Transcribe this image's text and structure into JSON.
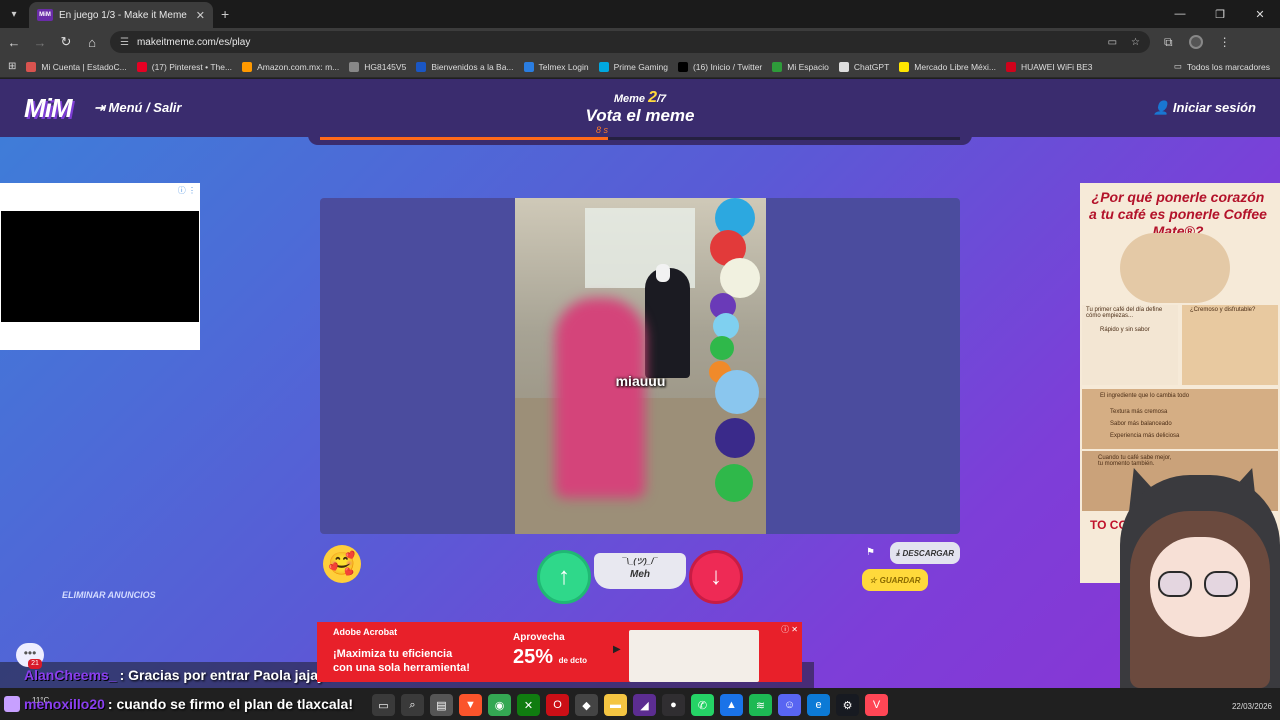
{
  "browser": {
    "tab_title": "En juego 1/3 - Make it Meme",
    "tab_favicon": "MiM",
    "url": "makeitmeme.com/es/play",
    "bookmarks": [
      {
        "label": "Mi Cuenta | EstadoC...",
        "color": "#d9534f"
      },
      {
        "label": "(17) Pinterest • The...",
        "color": "#e60023"
      },
      {
        "label": "Amazon.com.mx: m...",
        "color": "#ff9900"
      },
      {
        "label": "HG8145V5",
        "color": "#888888"
      },
      {
        "label": "Bienvenidos a la Ba...",
        "color": "#1a56c4"
      },
      {
        "label": "Telmex Login",
        "color": "#2a7de1"
      },
      {
        "label": "Prime Gaming",
        "color": "#00a8e1"
      },
      {
        "label": "(16) Inicio / Twitter",
        "color": "#000000"
      },
      {
        "label": "Mi Espacio",
        "color": "#2e9b3a"
      },
      {
        "label": "ChatGPT",
        "color": "#dddddd"
      },
      {
        "label": "Mercado Libre Méxi...",
        "color": "#ffe600"
      },
      {
        "label": "HUAWEI WiFi BE3",
        "color": "#d0021b"
      }
    ],
    "all_bookmarks": "Todos los marcadores"
  },
  "game": {
    "logo": "MiM",
    "menu_label": "Menú / Salir",
    "login_label": "Iniciar sesión",
    "round_prefix": "Meme",
    "round_current": "2",
    "round_total": "/7",
    "vote_title": "Vota el meme",
    "timer": "8 s",
    "timer_progress": 0.45,
    "meme_caption": "miauuu",
    "meh_face": "¯\\_(ツ)_/¯",
    "meh_label": "Meh",
    "download_label": "DESCARGAR",
    "save_label": "GUARDAR",
    "remove_ads": "ELIMINAR ANUNCIOS"
  },
  "ads": {
    "right_headline": "¿Por qué ponerle corazón a tu café es ponerle Coffee Mate®?",
    "right_texts": [
      "Tu primer café del día define cómo empiezas...",
      "Rápido y sin sabor",
      "¿Cremoso y disfrutable?",
      "El ingrediente que lo cambia todo",
      "Textura más cremosa",
      "Sabor más balanceado",
      "Experiencia más deliciosa",
      "Cuando tu café sabe mejor, tu momento también."
    ],
    "right_promo": "TO CON",
    "bottom_brand": "Adobe Acrobat",
    "bottom_head": "¡Maximiza tu eficiencia",
    "bottom_sub": "con una sola herramienta!",
    "bottom_apro": "Aprovecha",
    "bottom_pct": "25%",
    "bottom_pct_sub": "de dcto"
  },
  "chat": [
    {
      "user": "AlanCheems_",
      "message": ": Gracias por entrar Paola jajaja"
    },
    {
      "user": "menoxillo20",
      "message": ": cuando se firmo el plan de tlaxcala!"
    }
  ],
  "chat_badge": "21",
  "taskbar": {
    "weather": "11°C",
    "date": "22/03/2026",
    "apps": [
      {
        "icon": "task-view-icon",
        "color": "#3a3a3a",
        "glyph": "▭"
      },
      {
        "icon": "search-icon",
        "color": "#3a3a3a",
        "glyph": "⌕"
      },
      {
        "icon": "files-icon",
        "color": "#555555",
        "glyph": "▤"
      },
      {
        "icon": "brave-icon",
        "color": "#fb542b",
        "glyph": "▼"
      },
      {
        "icon": "chrome-icon",
        "color": "#34a853",
        "glyph": "◉"
      },
      {
        "icon": "xbox-icon",
        "color": "#107c10",
        "glyph": "✕"
      },
      {
        "icon": "opera-icon",
        "color": "#cc0f16",
        "glyph": "O"
      },
      {
        "icon": "github-icon",
        "color": "#444444",
        "glyph": "◆"
      },
      {
        "icon": "folder-icon",
        "color": "#f4c542",
        "glyph": "▬"
      },
      {
        "icon": "vs-icon",
        "color": "#5c2d91",
        "glyph": "◢"
      },
      {
        "icon": "obs-icon",
        "color": "#302e31",
        "glyph": "●"
      },
      {
        "icon": "whatsapp-icon",
        "color": "#25d366",
        "glyph": "✆"
      },
      {
        "icon": "photos-icon",
        "color": "#1a73e8",
        "glyph": "▲"
      },
      {
        "icon": "spotify-icon",
        "color": "#1db954",
        "glyph": "≋"
      },
      {
        "icon": "discord-icon",
        "color": "#5865f2",
        "glyph": "☺"
      },
      {
        "icon": "edge-icon",
        "color": "#0c7ad6",
        "glyph": "e"
      },
      {
        "icon": "steam-icon",
        "color": "#171a21",
        "glyph": "⚙"
      },
      {
        "icon": "valorant-icon",
        "color": "#ff4655",
        "glyph": "V"
      }
    ]
  },
  "colors": {
    "upvote": "#2fd88a",
    "downvote": "#ee2a55",
    "accent": "#ffd93b",
    "header": "#3a2c6e"
  }
}
